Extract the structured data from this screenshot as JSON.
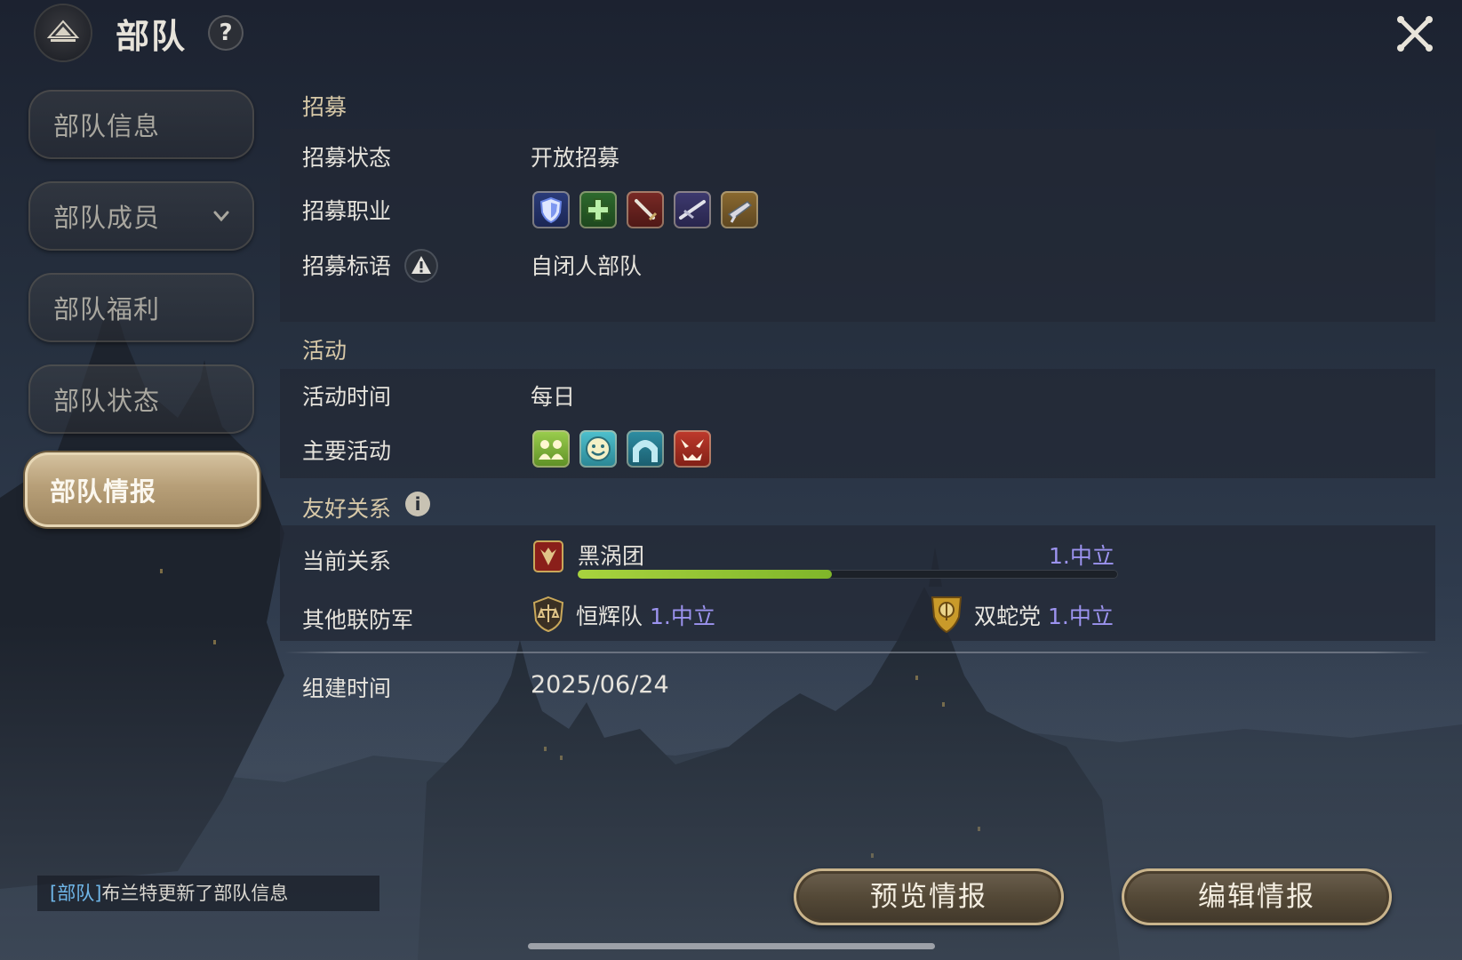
{
  "header": {
    "title": "部队",
    "help_label": "?"
  },
  "sidebar": {
    "items": [
      {
        "label": "部队信息"
      },
      {
        "label": "部队成员"
      },
      {
        "label": "部队福利"
      },
      {
        "label": "部队状态"
      },
      {
        "label": "部队情报"
      }
    ],
    "active_index": 4
  },
  "recruit": {
    "section_title": "招募",
    "status_label": "招募状态",
    "status_value": "开放招募",
    "jobs_label": "招募职业",
    "jobs_icons": [
      "shield-icon",
      "healer-cross-icon",
      "sword-icon",
      "lance-icon",
      "gun-icon"
    ],
    "slogan_label": "招募标语",
    "slogan_value": "自闭人部队"
  },
  "activity": {
    "section_title": "活动",
    "time_label": "活动时间",
    "time_value": "每日",
    "main_label": "主要活动",
    "main_icons": [
      "social-icon",
      "smile-icon",
      "dungeon-icon",
      "boss-icon"
    ]
  },
  "relations": {
    "section_title": "友好关系",
    "current_label": "当前关系",
    "current_name": "黑涡团",
    "current_rank": "1.中立",
    "current_progress": 0.47,
    "others_label": "其他联防军",
    "others": [
      {
        "name": "恒辉队",
        "rank": "1.中立"
      },
      {
        "name": "双蛇党",
        "rank": "1.中立"
      }
    ]
  },
  "founded": {
    "label": "组建时间",
    "value": "2025/06/24"
  },
  "log": {
    "tag": "[部队]",
    "text": "布兰特更新了部队信息"
  },
  "buttons": {
    "preview": "预览情报",
    "edit": "编辑情报"
  },
  "colors": {
    "accent_gold": "#d8c9a8",
    "rank_violet": "#9c93ef",
    "progress_green": "#a8d33e",
    "log_tag_blue": "#6fb6e8"
  }
}
